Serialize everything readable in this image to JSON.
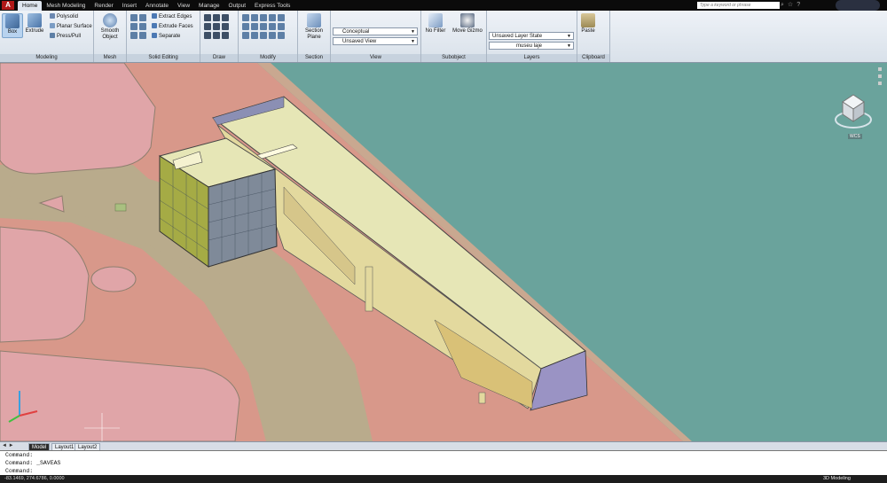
{
  "app": {
    "logo": "A"
  },
  "tabs": [
    "Home",
    "Mesh Modeling",
    "Render",
    "Insert",
    "Annotate",
    "View",
    "Manage",
    "Output",
    "Express Tools"
  ],
  "search": {
    "placeholder": "Type a keyword or phrase"
  },
  "ribbon": {
    "modeling": {
      "title": "Modeling",
      "box": "Box",
      "extrude": "Extrude",
      "polysolid": "Polysolid",
      "planar_surface": "Planar Surface",
      "press_pull": "Press/Pull"
    },
    "mesh": {
      "title": "Mesh",
      "smooth_object": "Smooth Object"
    },
    "solid_editing": {
      "title": "Solid Editing",
      "extract_edges": "Extract Edges",
      "extrude_faces": "Extrude Faces",
      "separate": "Separate"
    },
    "draw": {
      "title": "Draw"
    },
    "modify": {
      "title": "Modify"
    },
    "section": {
      "title": "Section",
      "section_plane": "Section Plane"
    },
    "view": {
      "title": "View",
      "visual_style": "Conceptual",
      "named_view": "Unsaved View"
    },
    "subobject": {
      "title": "Subobject",
      "no_filter": "No Filter",
      "move_gizmo": "Move Gizmo"
    },
    "layers": {
      "title": "Layers",
      "layer_state": "Unsaved Layer State",
      "current_layer": "museu laje"
    },
    "clipboard": {
      "title": "Clipboard",
      "paste": "Paste"
    }
  },
  "viewcube": {
    "wcs": "WCS"
  },
  "layout_tabs": [
    "Model",
    "Layout1",
    "Layout2"
  ],
  "command": {
    "lines": [
      "Command:",
      "Command: _SAVEAS",
      "Command:"
    ]
  },
  "status": {
    "coords": "-83.1469, 274.6786, 0.0000",
    "workspace": "3D Modeling"
  },
  "colors": {
    "water": "#6aa39c",
    "ground": "#d8988a",
    "road": "#b9ab8c",
    "building_roof": "#e6e6b6",
    "glass": "#a5ab45",
    "ribbon": "#dfe6ef"
  }
}
